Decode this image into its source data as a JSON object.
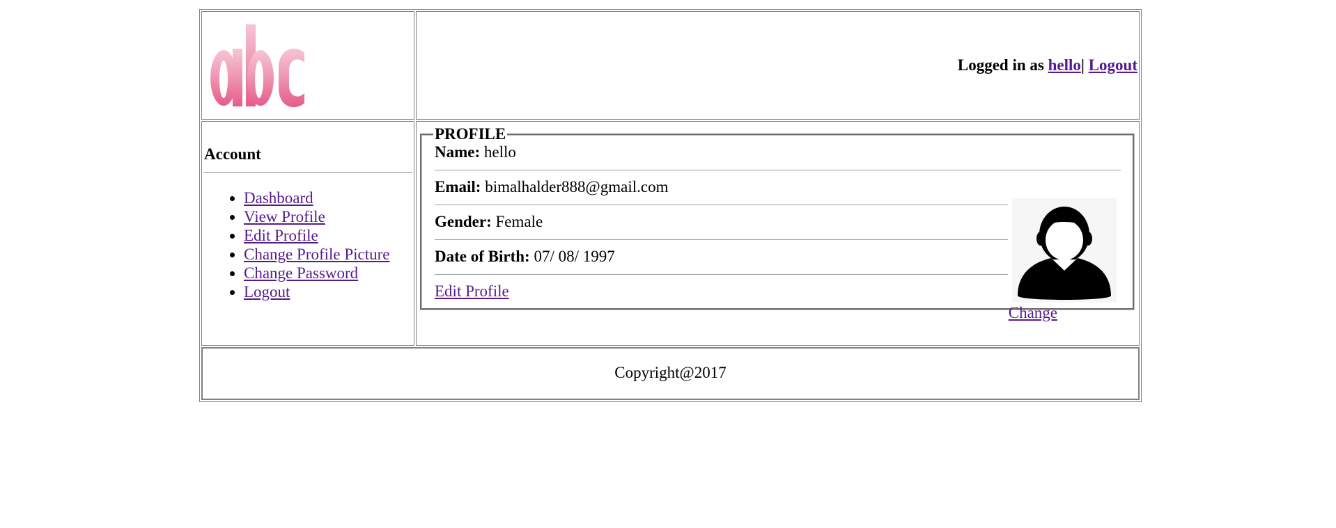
{
  "header": {
    "logo_text": "abc",
    "logged_in_prefix": "Logged in as",
    "username": "hello",
    "separator": "|",
    "logout_label": "Logout"
  },
  "sidebar": {
    "title": "Account",
    "items": [
      {
        "label": "Dashboard"
      },
      {
        "label": "View Profile"
      },
      {
        "label": "Edit Profile"
      },
      {
        "label": "Change Profile Picture"
      },
      {
        "label": "Change Password"
      },
      {
        "label": "Logout"
      }
    ]
  },
  "profile": {
    "legend": "PROFILE",
    "name_label": "Name:",
    "name_value": "hello",
    "email_label": "Email:",
    "email_value": "bimalhalder888@gmail.com",
    "gender_label": "Gender:",
    "gender_value": "Female",
    "dob_label": "Date of Birth:",
    "dob_value": "07/ 08/ 1997",
    "edit_label": "Edit Profile",
    "change_label": "Change",
    "avatar_icon": "user-avatar-icon"
  },
  "footer": {
    "copyright": "Copyright@2017"
  },
  "colors": {
    "link": "#551a8b",
    "logo_pink": "#e9688f",
    "border": "#808080"
  }
}
